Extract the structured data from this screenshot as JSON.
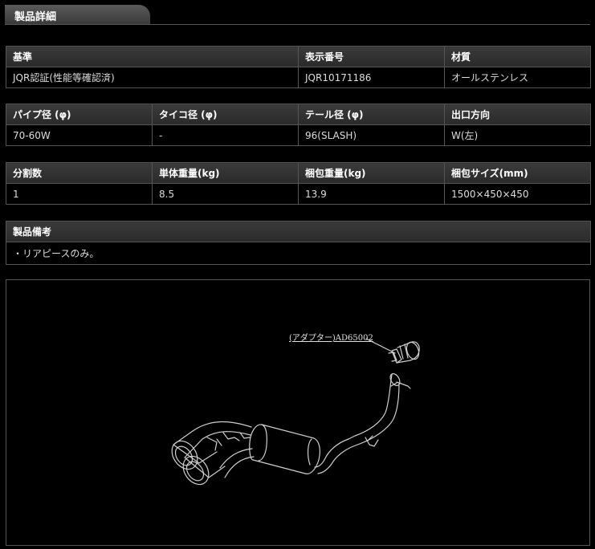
{
  "header": {
    "title": "製品詳細"
  },
  "table1": {
    "headers": [
      "基準",
      "表示番号",
      "材質"
    ],
    "values": [
      "JQR認証(性能等確認済)",
      "JQR10171186",
      "オールステンレス"
    ]
  },
  "table2": {
    "headers": [
      "パイプ径 (φ)",
      "タイコ径 (φ)",
      "テール径 (φ)",
      "出口方向"
    ],
    "values": [
      "70-60W",
      "-",
      "96(SLASH)",
      "W(左)"
    ]
  },
  "table3": {
    "headers": [
      "分割数",
      "単体重量(kg)",
      "梱包重量(kg)",
      "梱包サイズ(mm)"
    ],
    "values": [
      "1",
      "8.5",
      "13.9",
      "1500×450×450"
    ]
  },
  "table4": {
    "headers": [
      "製品備考"
    ],
    "values": [
      "・リアピースのみ。"
    ]
  },
  "diagram": {
    "adapter_label": "(アダプター)AD65002"
  }
}
